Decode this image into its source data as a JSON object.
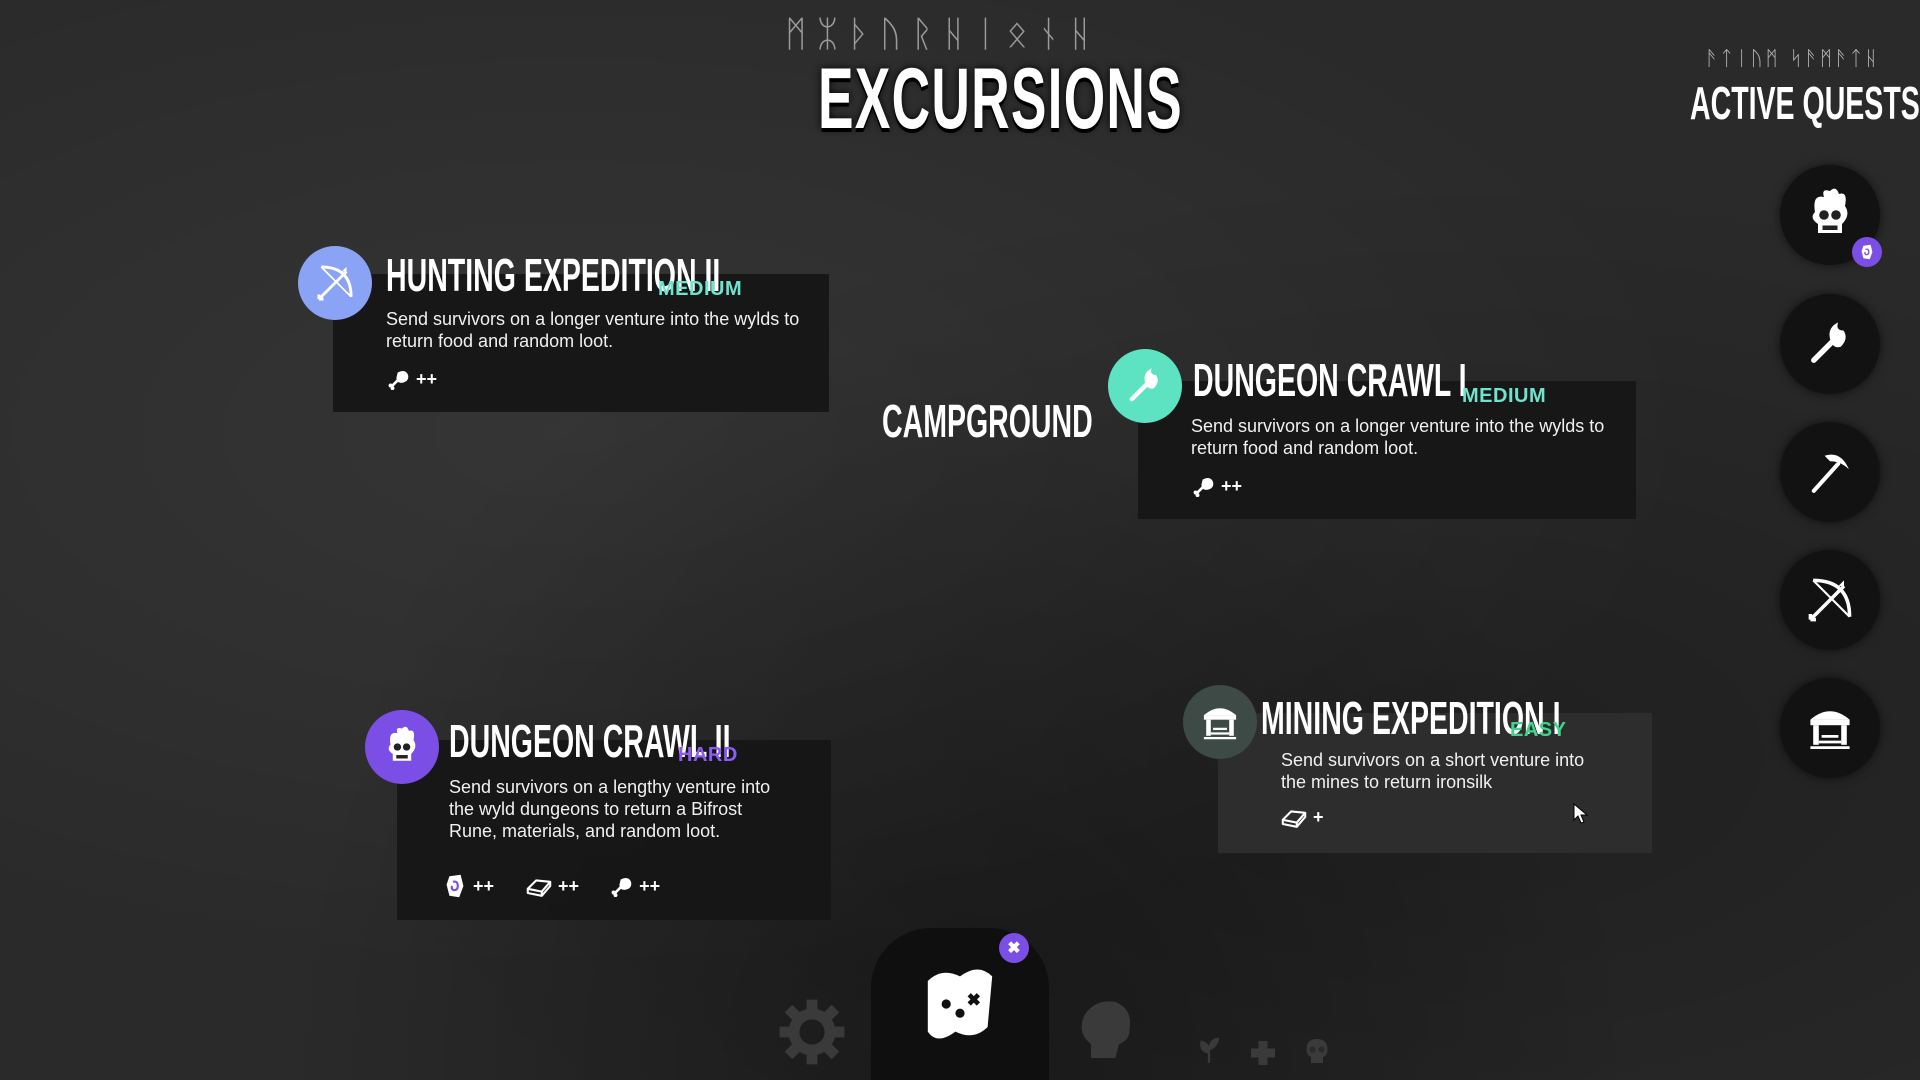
{
  "header": {
    "runes": "ᛗᛯᚦᚢᚱᚺᛁᛟᚾᚺ",
    "title": "EXCURSIONS"
  },
  "quests": {
    "runes": "ᚫᛏᛁᚢᛗ ᛋᚫᛗᚫᛏᚺ",
    "title": "ACTIVE QUESTS"
  },
  "campground": "CAMPGROUND",
  "cards": [
    {
      "title": "HUNTING EXPEDITION II",
      "difficulty": "MEDIUM",
      "description": "Send survivors on a longer venture into the wylds to return food and random loot.",
      "rewards": [
        {
          "icon": "meat-icon",
          "amount": "++"
        }
      ],
      "badge_icon": "bow-icon",
      "badge_color": "#8aa3f5",
      "difficulty_color": "#6fe3ce"
    },
    {
      "title": "DUNGEON CRAWL I",
      "difficulty": "MEDIUM",
      "description": "Send survivors on a longer venture into the wylds to return food and random loot.",
      "rewards": [
        {
          "icon": "meat-icon",
          "amount": "++"
        }
      ],
      "badge_icon": "torch-icon",
      "badge_color": "#5ee3c2",
      "difficulty_color": "#6fe3ce"
    },
    {
      "title": "DUNGEON CRAWL II",
      "difficulty": "HARD",
      "description": "Send survivors on a lengthy venture into the wyld dungeons to return a Bifrost Rune, materials, and random loot.",
      "rewards": [
        {
          "icon": "rune-stone-icon",
          "amount": "++"
        },
        {
          "icon": "ingot-icon",
          "amount": "++"
        },
        {
          "icon": "meat-icon",
          "amount": "++"
        }
      ],
      "badge_icon": "flaming-skull-icon",
      "badge_color": "#7b4fe6",
      "difficulty_color": "#8b5cf6"
    },
    {
      "title": "MINING EXPEDITION I",
      "difficulty": "EASY",
      "description": "Send survivors on a short venture into the mines to return ironsilk",
      "rewards": [
        {
          "icon": "ingot-icon",
          "amount": "+"
        }
      ],
      "badge_icon": "mine-icon",
      "badge_color": "#3e4a45",
      "difficulty_color": "#3fd48a"
    }
  ],
  "sidebar": [
    {
      "icon": "flaming-skull-icon"
    },
    {
      "icon": "torch-icon"
    },
    {
      "icon": "pickaxe-icon"
    },
    {
      "icon": "bow-icon"
    },
    {
      "icon": "mine-icon"
    }
  ],
  "dock": {
    "close_symbol": "✖",
    "icons": [
      "gear-icon",
      "map-icon",
      "head-icon",
      "herb-icon",
      "plus-icon",
      "skull-icon"
    ]
  }
}
